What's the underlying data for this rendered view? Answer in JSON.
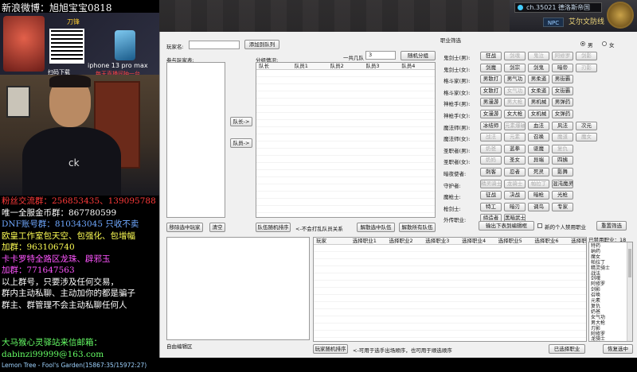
{
  "overlay": {
    "title": "新浪微博：旭旭宝宝0818",
    "promo": {
      "brand": "刀锋",
      "caption": "iphone 13 pro max",
      "caption2": "每天直播间抽一台",
      "caption3": "扫码下载"
    },
    "webcam_logo": "ck",
    "lines": [
      {
        "text": "粉丝交流群：256853435、139095788",
        "color": "red"
      },
      {
        "text": "唯一全服金币群：867780599",
        "color": "white"
      },
      {
        "text": "DNF账号群：810343045 只收不卖",
        "color": "blue"
      },
      {
        "text": "欧皇工作室包天空、包强化、包增幅",
        "color": "yellow"
      },
      {
        "text": "加群：963106740",
        "color": "yellow"
      },
      {
        "text": "卡卡罗特全路区龙珠、辟邪玉",
        "color": "mag"
      },
      {
        "text": "加群：771647563",
        "color": "mag"
      },
      {
        "text": "以上群号，只要涉及任何交易，",
        "color": "white"
      },
      {
        "text": "群内主动私聊、主动加你的都是骗子",
        "color": "white"
      },
      {
        "text": "群主、群管理不会主动私聊任何人",
        "color": "white"
      }
    ],
    "mail_label": "大马猴心灵驿站来信邮箱：",
    "mail_address": "dabinzi99999@163.com",
    "song": "Lemon Tree - Fool's Garden(15867:35/15972:27)"
  },
  "banner": {
    "channel": "ch.35021 德洛斯帝国",
    "npc": "NPC",
    "location": "艾尔文防线"
  },
  "app": {
    "player_name_label": "玩家名:",
    "add_team_btn": "添加到队列",
    "joined_players_label": "参与玩家表:",
    "group_status_label": "分组情况:",
    "team_count_label": "一共几队",
    "team_count_value": "3",
    "random_group_btn": "随机分组",
    "grid_cols": [
      "队长",
      "队员1",
      "队员2",
      "队员3",
      "队员4"
    ],
    "to_team_btn": "队长->",
    "to_member_btn": "队员->",
    "remove_selected_btn": "移除选中玩家",
    "clear_btn": "清空",
    "team_random_sort_btn": "队伍随机排序",
    "no_team_hint": "<-不会打乱队员关系",
    "dissolve_selected_btn": "解散选中队伍",
    "dissolve_all_btn": "解散所有队伍",
    "job_filter_label": "职业筛选",
    "gender_male": "男",
    "gender_female": "女",
    "job_rows": [
      {
        "label": "鬼剑士(男):",
        "jobs": [
          {
            "t": "狂战",
            "d": false
          },
          {
            "t": "剑魂",
            "d": true
          },
          {
            "t": "鬼泣",
            "d": true
          },
          {
            "t": "阿修罗",
            "d": true
          },
          {
            "t": "剑影",
            "d": true
          }
        ]
      },
      {
        "label": "鬼剑士(女):",
        "jobs": [
          {
            "t": "剑魔",
            "d": false
          },
          {
            "t": "剑宗",
            "d": false
          },
          {
            "t": "剑鬼",
            "d": false
          },
          {
            "t": "暗帝",
            "d": false
          },
          {
            "t": "刃影",
            "d": true
          }
        ]
      },
      {
        "label": "格斗家(男):",
        "jobs": [
          {
            "t": "男散打",
            "d": false
          },
          {
            "t": "男气功",
            "d": false
          },
          {
            "t": "男柔道",
            "d": false
          },
          {
            "t": "男街霸",
            "d": false
          }
        ]
      },
      {
        "label": "格斗家(女):",
        "jobs": [
          {
            "t": "女散打",
            "d": false
          },
          {
            "t": "女气功",
            "d": true
          },
          {
            "t": "女柔道",
            "d": false
          },
          {
            "t": "女街霸",
            "d": false
          }
        ]
      },
      {
        "label": "神枪手(男):",
        "jobs": [
          {
            "t": "男漫游",
            "d": false
          },
          {
            "t": "男大枪",
            "d": true
          },
          {
            "t": "男机械",
            "d": false
          },
          {
            "t": "男弹药",
            "d": false
          }
        ]
      },
      {
        "label": "神枪手(女):",
        "jobs": [
          {
            "t": "女漫游",
            "d": false
          },
          {
            "t": "女大枪",
            "d": false
          },
          {
            "t": "女机械",
            "d": false
          },
          {
            "t": "女弹药",
            "d": false
          }
        ]
      },
      {
        "label": "魔法师(男):",
        "jobs": [
          {
            "t": "冰结师",
            "d": false
          },
          {
            "t": "元素爆破",
            "d": true
          },
          {
            "t": "血法",
            "d": false
          },
          {
            "t": "风法",
            "d": false
          },
          {
            "t": "次元",
            "d": false
          }
        ]
      },
      {
        "label": "魔法师(女):",
        "jobs": [
          {
            "t": "战法",
            "d": true
          },
          {
            "t": "元素",
            "d": true
          },
          {
            "t": "召唤",
            "d": false
          },
          {
            "t": "魔道",
            "d": true
          },
          {
            "t": "魔女",
            "d": true
          }
        ]
      },
      {
        "label": "圣职者(男):",
        "jobs": [
          {
            "t": "奶爸",
            "d": true
          },
          {
            "t": "蓝拳",
            "d": false
          },
          {
            "t": "驱魔",
            "d": false
          },
          {
            "t": "复仇",
            "d": true
          }
        ]
      },
      {
        "label": "圣职者(女):",
        "jobs": [
          {
            "t": "奶妈",
            "d": true
          },
          {
            "t": "圣女",
            "d": false
          },
          {
            "t": "异端",
            "d": false
          },
          {
            "t": "四姨",
            "d": false
          }
        ]
      },
      {
        "label": "暗夜使者:",
        "jobs": [
          {
            "t": "刺客",
            "d": false
          },
          {
            "t": "忍者",
            "d": false
          },
          {
            "t": "死灵",
            "d": false
          },
          {
            "t": "影舞",
            "d": false
          }
        ]
      },
      {
        "label": "守护者:",
        "jobs": [
          {
            "t": "精灵骑士",
            "d": true
          },
          {
            "t": "龙骑士",
            "d": true
          },
          {
            "t": "帕拉丁",
            "d": true
          },
          {
            "t": "混沌魔灵",
            "d": false
          }
        ]
      },
      {
        "label": "魔枪士:",
        "jobs": [
          {
            "t": "征战",
            "d": false
          },
          {
            "t": "决战",
            "d": false
          },
          {
            "t": "暗枪",
            "d": false
          },
          {
            "t": "光枪",
            "d": false
          }
        ]
      },
      {
        "label": "枪剑士:",
        "jobs": [
          {
            "t": "特工",
            "d": false
          },
          {
            "t": "暗刃",
            "d": false
          },
          {
            "t": "调鸟",
            "d": false
          },
          {
            "t": "专家",
            "d": false
          }
        ]
      },
      {
        "label": "外传职业:",
        "jobs": [
          {
            "t": "缔造者",
            "d": false
          },
          {
            "t": "黑暗武士",
            "d": false
          }
        ]
      }
    ],
    "output_box_label": "自由编辑区",
    "export_list_btn": "输出下表到编辑框",
    "new_players_only_label": "新的个人禁用职业",
    "reset_filter_btn": "重置筛选",
    "bottom_grid_cols": [
      "玩家",
      "选择职业1",
      "选择职业2",
      "选择职业3",
      "选择职业4",
      "选择职业5",
      "选择职业6",
      "选择职业"
    ],
    "banned_label": "已禁用职业：18",
    "banned_list": [
      "特药",
      "纳药",
      "魔女",
      "帕拉丁",
      "精灵骑士",
      "战法",
      "剑魂",
      "阿修罗",
      "剑影",
      "召唤",
      "元素",
      "复仇",
      "奶爸",
      "女气功",
      "男大枪",
      "刃影",
      "阿修罗",
      "龙骑士",
      "魔道",
      "奶妈"
    ],
    "player_random_sort_btn": "玩家随机排序",
    "bottom_hint": "<-可用于选手出场顺序，也可用于顺选顺序",
    "selected_jobs_btn": "已选择职业",
    "restore_btn": "恢复选中"
  }
}
